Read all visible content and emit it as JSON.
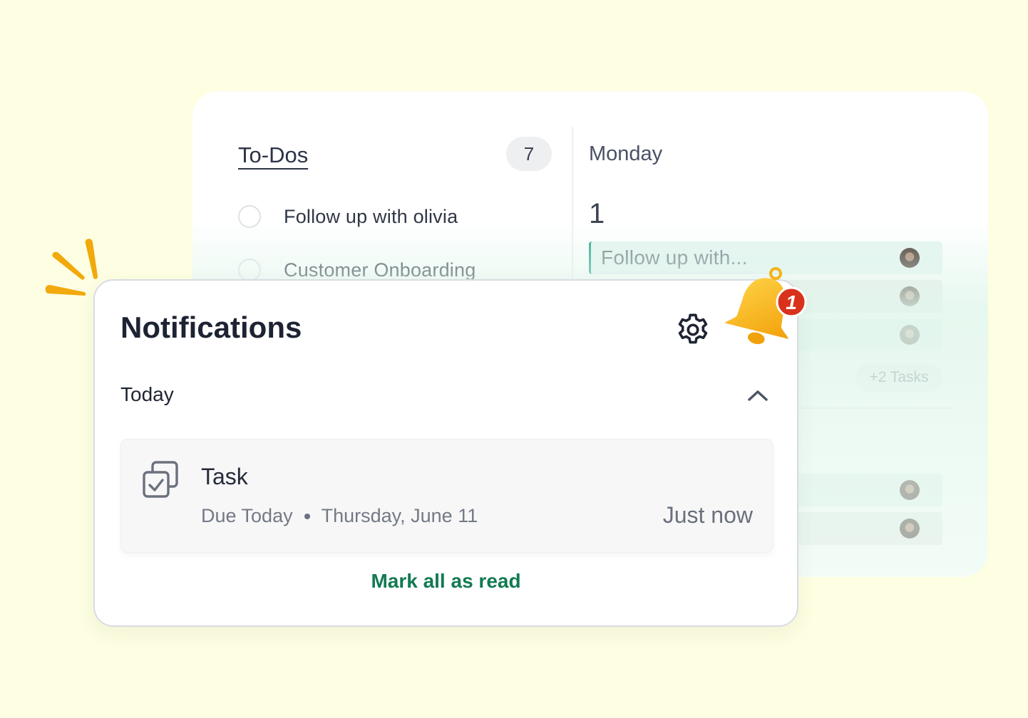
{
  "todos": {
    "title": "To-Dos",
    "count": "7",
    "items": [
      {
        "label": "Follow up with olivia"
      },
      {
        "label": "Customer Onboarding"
      }
    ]
  },
  "calendar": {
    "day_name": "Monday",
    "day_number": "1",
    "events": [
      {
        "label": "Follow up with..."
      },
      {
        "label": ""
      },
      {
        "label": ""
      },
      {
        "label": ""
      },
      {
        "label": ""
      }
    ],
    "more_label": "+2 Tasks"
  },
  "notifications": {
    "title": "Notifications",
    "section": "Today",
    "bell_badge": "1",
    "task": {
      "title": "Task",
      "due": "Due Today",
      "date": "Thursday, June 11",
      "time": "Just now"
    },
    "mark_all_label": "Mark all as read"
  },
  "colors": {
    "background": "#fdfee2",
    "accent_green": "#127a52",
    "event_teal": "#22a48a",
    "bell_yellow": "#f9b313",
    "badge_red": "#d8321c",
    "sparkle": "#f1a90b"
  },
  "icons": [
    "gear-icon",
    "chevron-up-icon",
    "task-checkbox-icon",
    "bell-icon"
  ]
}
